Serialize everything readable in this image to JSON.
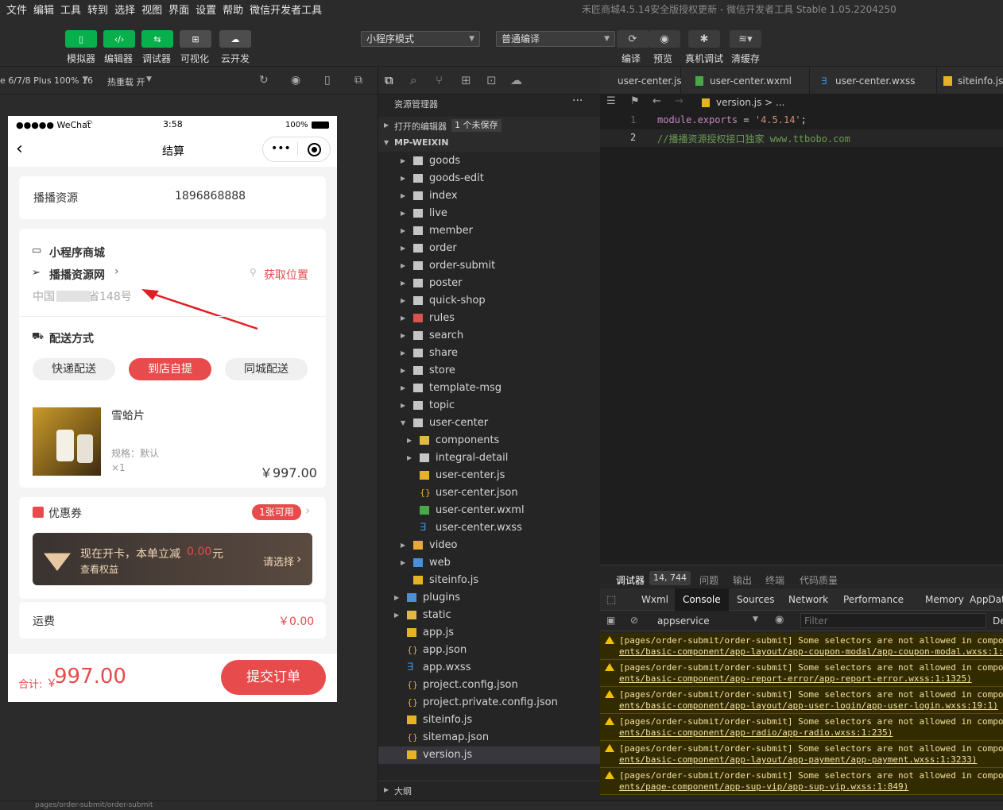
{
  "menubar": {
    "items": [
      "文件",
      "编辑",
      "工具",
      "转到",
      "选择",
      "视图",
      "界面",
      "设置",
      "帮助",
      "微信开发者工具"
    ],
    "title": "禾匠商城4.5.14安全版授权更新 - 微信开发者工具 Stable 1.05.2204250"
  },
  "toolbar": {
    "buttons": [
      {
        "label": "模拟器",
        "icon": "phone-icon"
      },
      {
        "label": "编辑器",
        "icon": "code-icon"
      },
      {
        "label": "调试器",
        "icon": "debug-icon"
      },
      {
        "label": "可视化",
        "icon": "layout-icon"
      },
      {
        "label": "云开发",
        "icon": "cloud-icon"
      }
    ],
    "mode_select": "小程序模式",
    "compile_select": "普通编译",
    "actions": [
      "编译",
      "预览",
      "真机调试",
      "清缓存"
    ]
  },
  "simbar": {
    "device": "e 6/7/8 Plus 100% 16",
    "hotreload": "热重载 开"
  },
  "phone": {
    "status": {
      "carrier": "●●●●● WeChat",
      "time": "3:58",
      "battery": "100%"
    },
    "nav_title": "结算",
    "contact": {
      "name": "播播资源",
      "phone": "1896868888"
    },
    "store": {
      "title": "小程序商城",
      "name": "播播资源网",
      "location_btn": "获取位置",
      "address": "中国　　　省148号"
    },
    "delivery": {
      "title": "配送方式",
      "options": [
        "快递配送",
        "到店自提",
        "同城配送"
      ]
    },
    "product": {
      "name": "雪蛤片",
      "spec": "规格：默认",
      "qty": "×1",
      "price": "￥997.00"
    },
    "coupon": {
      "title": "优惠券",
      "badge": "1张可用"
    },
    "vip": {
      "text_prefix": "现在开卡，本单立减",
      "amount": "0.00",
      "text_suffix": "元",
      "link": "查看权益",
      "select": "请选择"
    },
    "shipping": {
      "label": "运费",
      "value": "￥0.00"
    },
    "total": {
      "label": "合计:",
      "currency": "￥",
      "amount": "997.00",
      "submit": "提交订单"
    }
  },
  "explorer": {
    "title": "资源管理器",
    "open_editors": "打开的编辑器",
    "unsaved": "1 个未保存",
    "root": "MP-WEIXIN",
    "outline": "大纲",
    "rows": [
      {
        "name": "goods",
        "type": "folder",
        "level": 1,
        "arrow": "closed"
      },
      {
        "name": "goods-edit",
        "type": "folder",
        "level": 1,
        "arrow": "closed"
      },
      {
        "name": "index",
        "type": "folder",
        "level": 1,
        "arrow": "closed"
      },
      {
        "name": "live",
        "type": "folder",
        "level": 1,
        "arrow": "closed"
      },
      {
        "name": "member",
        "type": "folder",
        "level": 1,
        "arrow": "closed"
      },
      {
        "name": "order",
        "type": "folder",
        "level": 1,
        "arrow": "closed"
      },
      {
        "name": "order-submit",
        "type": "folder",
        "level": 1,
        "arrow": "closed"
      },
      {
        "name": "poster",
        "type": "folder",
        "level": 1,
        "arrow": "closed"
      },
      {
        "name": "quick-shop",
        "type": "folder",
        "level": 1,
        "arrow": "closed"
      },
      {
        "name": "rules",
        "type": "folder-red",
        "level": 1,
        "arrow": "closed"
      },
      {
        "name": "search",
        "type": "folder",
        "level": 1,
        "arrow": "closed"
      },
      {
        "name": "share",
        "type": "folder",
        "level": 1,
        "arrow": "closed"
      },
      {
        "name": "store",
        "type": "folder",
        "level": 1,
        "arrow": "closed"
      },
      {
        "name": "template-msg",
        "type": "folder",
        "level": 1,
        "arrow": "closed"
      },
      {
        "name": "topic",
        "type": "folder",
        "level": 1,
        "arrow": "closed"
      },
      {
        "name": "user-center",
        "type": "folder-open",
        "level": 1,
        "arrow": "open"
      },
      {
        "name": "components",
        "type": "folder-yellow",
        "level": 2,
        "arrow": "closed"
      },
      {
        "name": "integral-detail",
        "type": "folder",
        "level": 2,
        "arrow": "closed"
      },
      {
        "name": "user-center.js",
        "type": "js",
        "level": 2,
        "arrow": ""
      },
      {
        "name": "user-center.json",
        "type": "json",
        "level": 2,
        "arrow": ""
      },
      {
        "name": "user-center.wxml",
        "type": "wxml",
        "level": 2,
        "arrow": ""
      },
      {
        "name": "user-center.wxss",
        "type": "wxss",
        "level": 2,
        "arrow": ""
      },
      {
        "name": "video",
        "type": "folder-orange",
        "level": 1,
        "arrow": "closed"
      },
      {
        "name": "web",
        "type": "folder-blue",
        "level": 1,
        "arrow": "closed"
      },
      {
        "name": "siteinfo.js",
        "type": "js",
        "level": 1,
        "arrow": ""
      },
      {
        "name": "plugins",
        "type": "folder-blue",
        "level": 0,
        "arrow": "closed"
      },
      {
        "name": "static",
        "type": "folder-yellow",
        "level": 0,
        "arrow": "closed"
      },
      {
        "name": "app.js",
        "type": "js",
        "level": 0,
        "arrow": ""
      },
      {
        "name": "app.json",
        "type": "json",
        "level": 0,
        "arrow": ""
      },
      {
        "name": "app.wxss",
        "type": "wxss",
        "level": 0,
        "arrow": ""
      },
      {
        "name": "project.config.json",
        "type": "json",
        "level": 0,
        "arrow": ""
      },
      {
        "name": "project.private.config.json",
        "type": "json",
        "level": 0,
        "arrow": ""
      },
      {
        "name": "siteinfo.js",
        "type": "js",
        "level": 0,
        "arrow": ""
      },
      {
        "name": "sitemap.json",
        "type": "json",
        "level": 0,
        "arrow": ""
      },
      {
        "name": "version.js",
        "type": "js",
        "level": 0,
        "arrow": "",
        "selected": true
      }
    ]
  },
  "editor": {
    "tabs": [
      "user-center.js",
      "user-center.wxml",
      "user-center.wxss",
      "siteinfo.js"
    ],
    "breadcrumb": "version.js > ...",
    "lines": [
      {
        "num": "1",
        "a": "module.exports",
        "b": " = ",
        "c": "'4.5.14'",
        "d": ";"
      },
      {
        "num": "2",
        "comment": "//播播资源授权接口独家 www.ttbobo.com"
      }
    ]
  },
  "devtools": {
    "top_tabs": [
      "调试器",
      "问题",
      "输出",
      "终端",
      "代码质量"
    ],
    "badge": "14, 744",
    "panel_tabs": [
      "Wxml",
      "Console",
      "Sources",
      "Network",
      "Performance",
      "Memory",
      "AppData"
    ],
    "context": "appservice",
    "filter_placeholder": "Filter",
    "default_levels": "De",
    "warnings": [
      {
        "l1": "[pages/order-submit/order-submit] Some selectors are not allowed in compo",
        "l2": "ents/basic-component/app-layout/app-coupon-modal/app-coupon-modal.wxss:1:"
      },
      {
        "l1": "[pages/order-submit/order-submit] Some selectors are not allowed in compo",
        "l2": "ents/basic-component/app-report-error/app-report-error.wxss:1:1325)"
      },
      {
        "l1": "[pages/order-submit/order-submit] Some selectors are not allowed in compo",
        "l2": "ents/basic-component/app-layout/app-user-login/app-user-login.wxss:19:1)"
      },
      {
        "l1": "[pages/order-submit/order-submit] Some selectors are not allowed in compo",
        "l2": "ents/basic-component/app-radio/app-radio.wxss:1:235)"
      },
      {
        "l1": "[pages/order-submit/order-submit] Some selectors are not allowed in compo",
        "l2": "ents/basic-component/app-layout/app-payment/app-payment.wxss:1:3233)"
      },
      {
        "l1": "[pages/order-submit/order-submit] Some selectors are not allowed in compo",
        "l2": "ents/page-component/app-sup-vip/app-sup-vip.wxss:1:849)"
      }
    ]
  },
  "statusbar": {
    "path": "pages/order-submit/order-submit"
  },
  "colors": {
    "accent": "#07b04a",
    "red": "#e84b4b",
    "warn_bg": "#332b00"
  }
}
